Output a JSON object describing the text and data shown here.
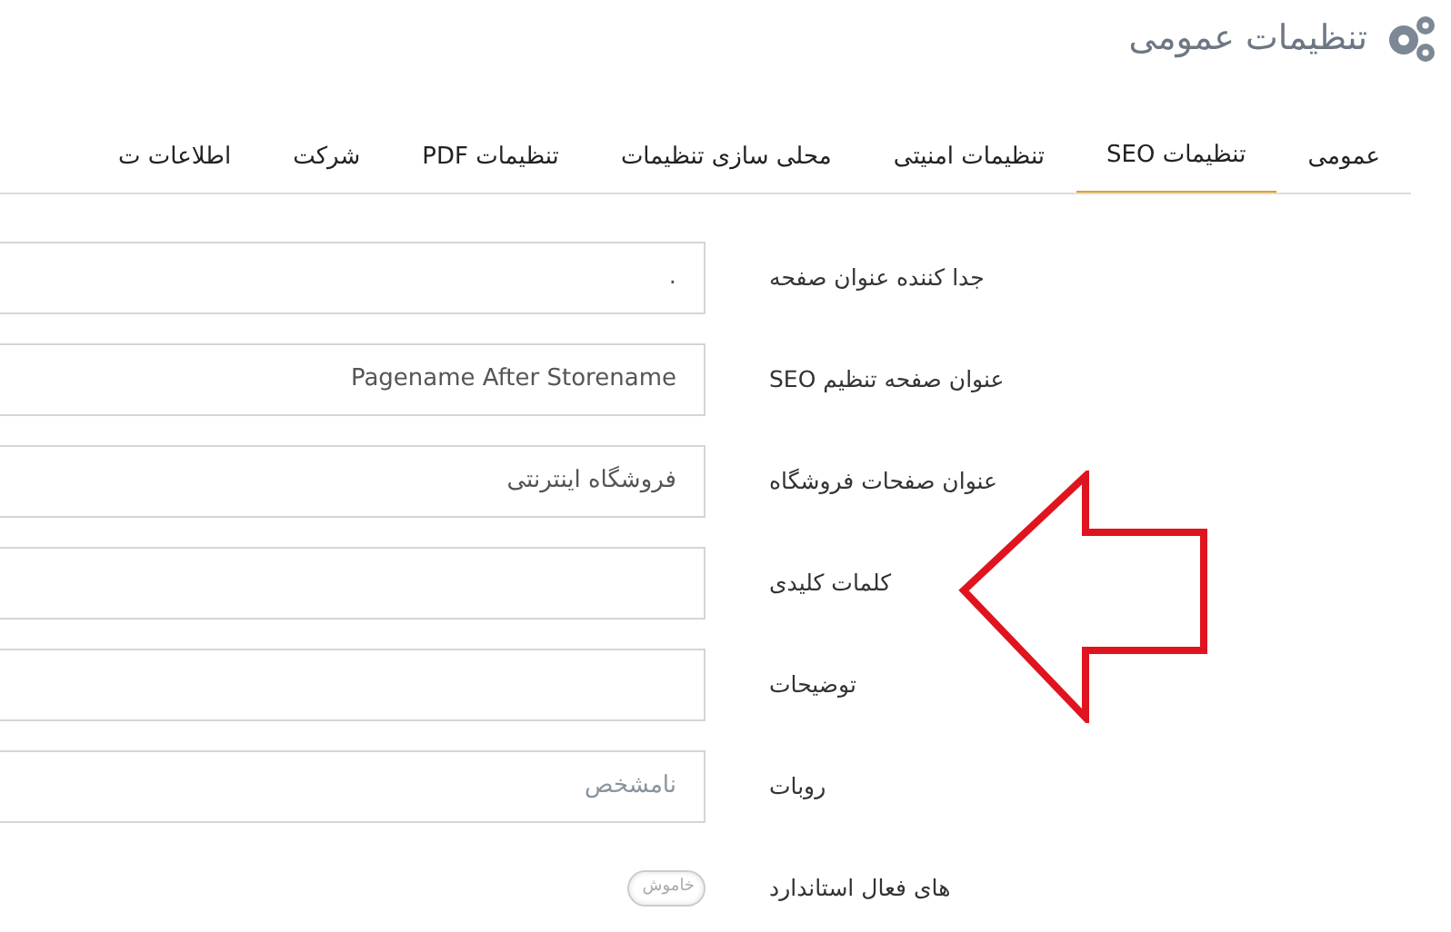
{
  "header": {
    "title": "تنظیمات عمومی"
  },
  "tabs": [
    {
      "label": "عمومی",
      "selected": false
    },
    {
      "label": "تنظیمات SEO",
      "selected": true
    },
    {
      "label": "تنظیمات امنیتی",
      "selected": false
    },
    {
      "label": "محلی سازی تنظیمات",
      "selected": false
    },
    {
      "label": "تنظیمات PDF",
      "selected": false
    },
    {
      "label": "شرکت",
      "selected": false
    },
    {
      "label": "اطلاعات ت",
      "selected": false
    }
  ],
  "fields": [
    {
      "kind": "text",
      "label": "جدا کننده عنوان صفحه",
      "value": "."
    },
    {
      "kind": "text",
      "label": "عنوان صفحه تنظیم SEO",
      "value": "Pagename After Storename"
    },
    {
      "kind": "text",
      "label": "عنوان صفحات فروشگاه",
      "value": "فروشگاه اینترنتی"
    },
    {
      "kind": "text",
      "label": "کلمات کلیدی"
    },
    {
      "kind": "text",
      "label": "توضیحات"
    },
    {
      "kind": "select",
      "label": "روبات",
      "placeholder": "نامشخص"
    },
    {
      "kind": "toggle",
      "label": "های فعال استاندارد",
      "on": false,
      "value": "خاموش"
    }
  ]
}
